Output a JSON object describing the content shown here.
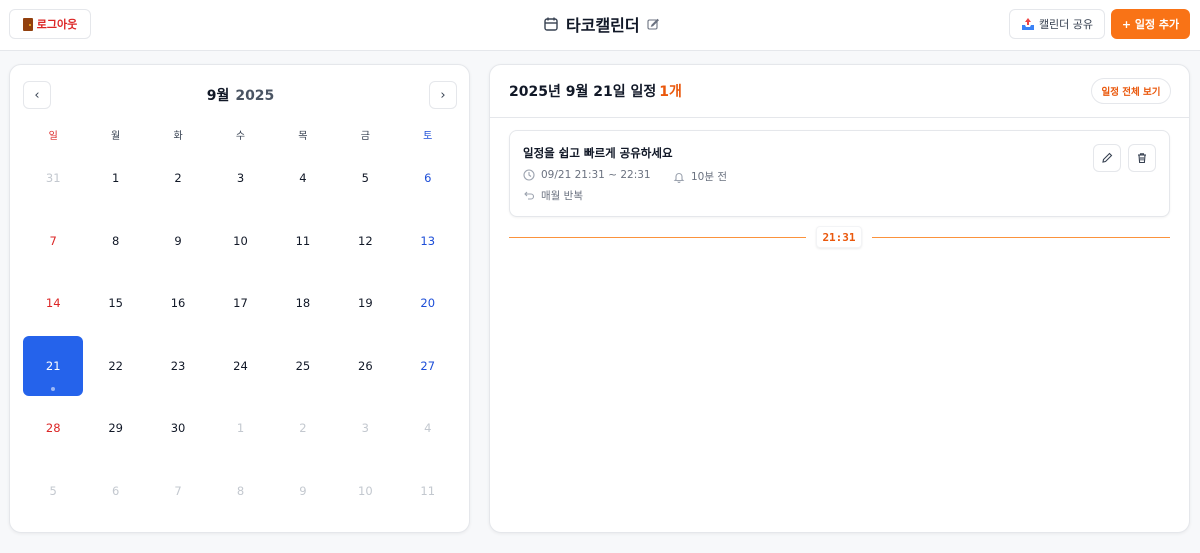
{
  "header": {
    "logout_label": "로그아웃",
    "app_title": "타코캘린더",
    "share_label": "캘린더 공유",
    "add_label": "+ 일정 추가"
  },
  "calendar": {
    "month_label": "9월",
    "year_label": "2025",
    "prev_label": "‹",
    "next_label": "›",
    "weekdays": [
      "일",
      "월",
      "화",
      "수",
      "목",
      "금",
      "토"
    ],
    "selected_day": "21",
    "weeks": [
      [
        "31",
        "1",
        "2",
        "3",
        "4",
        "5",
        "6"
      ],
      [
        "7",
        "8",
        "9",
        "10",
        "11",
        "12",
        "13"
      ],
      [
        "14",
        "15",
        "16",
        "17",
        "18",
        "19",
        "20"
      ],
      [
        "21",
        "22",
        "23",
        "24",
        "25",
        "26",
        "27"
      ],
      [
        "28",
        "29",
        "30",
        "1",
        "2",
        "3",
        "4"
      ],
      [
        "5",
        "6",
        "7",
        "8",
        "9",
        "10",
        "11"
      ]
    ]
  },
  "schedule": {
    "title": "2025년 9월 21일 일정",
    "count": "1개",
    "view_all_label": "일정 전체 보기",
    "events": [
      {
        "title": "일정을 쉽고 빠르게 공유하세요",
        "time": "09/21 21:31 ~ 22:31",
        "alarm": "10분 전",
        "repeat": "매월 반복"
      }
    ],
    "now_time": "21:31"
  },
  "colors": {
    "accent": "#f97316",
    "selected": "#2563eb",
    "sunday": "#dc2626",
    "saturday": "#1d4ed8"
  }
}
